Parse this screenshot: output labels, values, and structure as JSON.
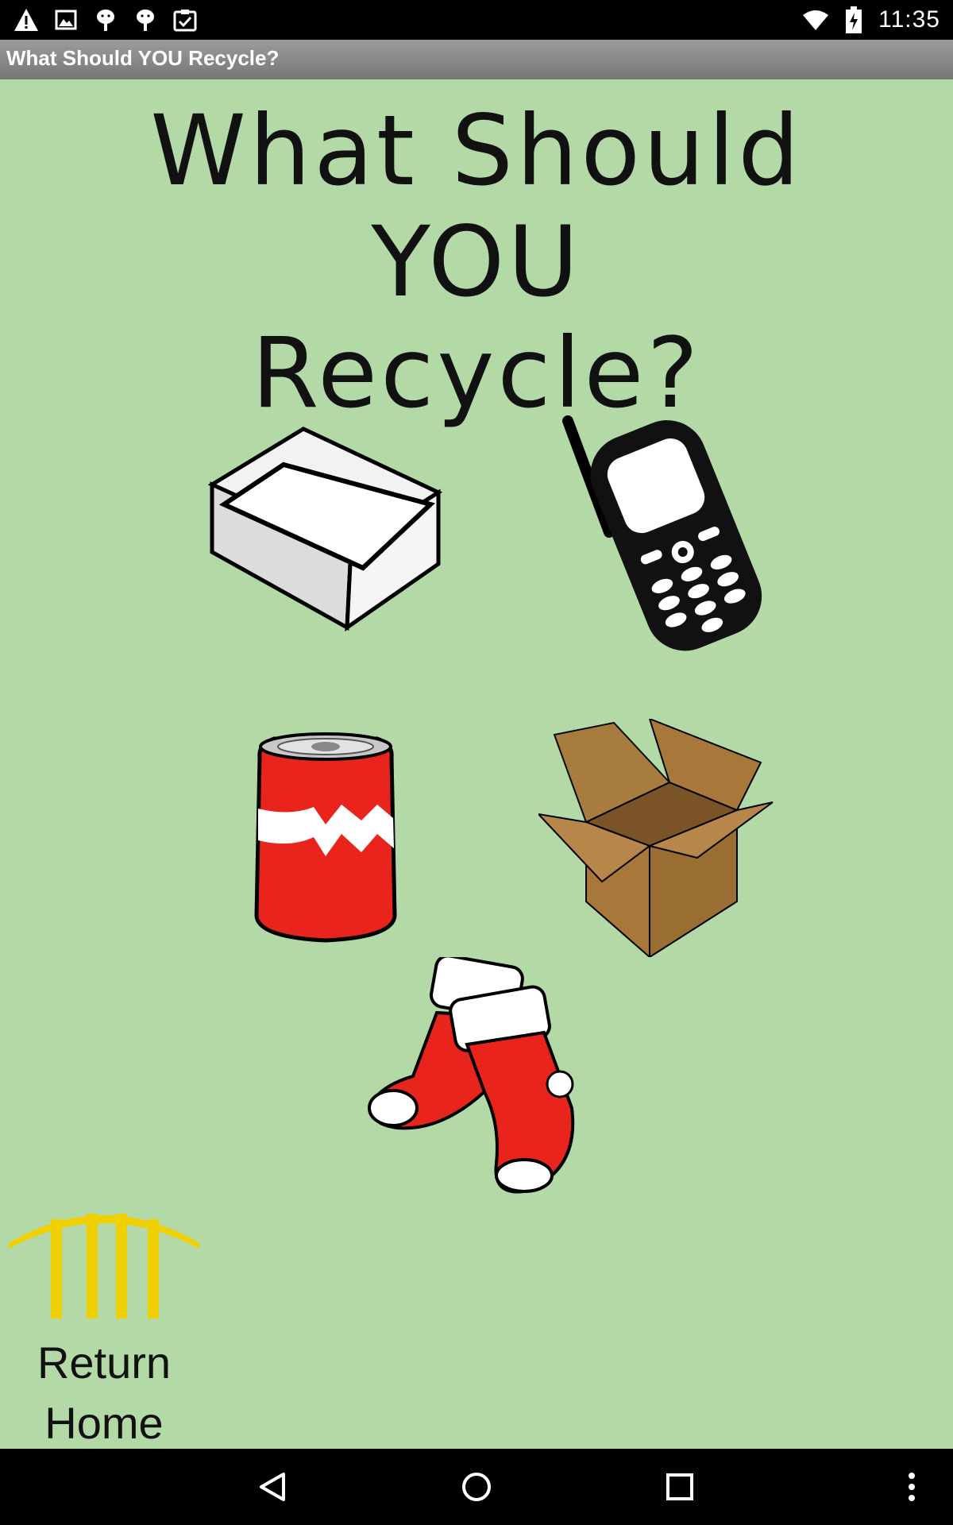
{
  "status_bar": {
    "time": "11:35",
    "left_icons": [
      "warning-icon",
      "image-icon",
      "android-icon",
      "android-icon",
      "clipboard-check-icon"
    ],
    "right_icons": [
      "wifi-icon",
      "battery-charging-icon"
    ]
  },
  "app_bar": {
    "title": "What Should YOU Recycle?"
  },
  "headline": {
    "line1": "What Should",
    "line2": "YOU",
    "line3": "Recycle?"
  },
  "items": [
    {
      "name": "paper",
      "icon": "paper-stack-icon"
    },
    {
      "name": "cell phone",
      "icon": "cell-phone-icon"
    },
    {
      "name": "soda can",
      "icon": "soda-can-icon"
    },
    {
      "name": "cardboard box",
      "icon": "cardboard-box-icon"
    },
    {
      "name": "socks",
      "icon": "socks-icon"
    }
  ],
  "home": {
    "line1": "Return",
    "line2": "Home"
  },
  "nav_bar": {
    "buttons": [
      "back-icon",
      "home-icon",
      "recents-icon",
      "overflow-menu-icon"
    ]
  },
  "colors": {
    "background": "#b3d9a7",
    "accent_yellow": "#f0d000",
    "can_red": "#e8241c",
    "box_brown": "#a8783a"
  }
}
